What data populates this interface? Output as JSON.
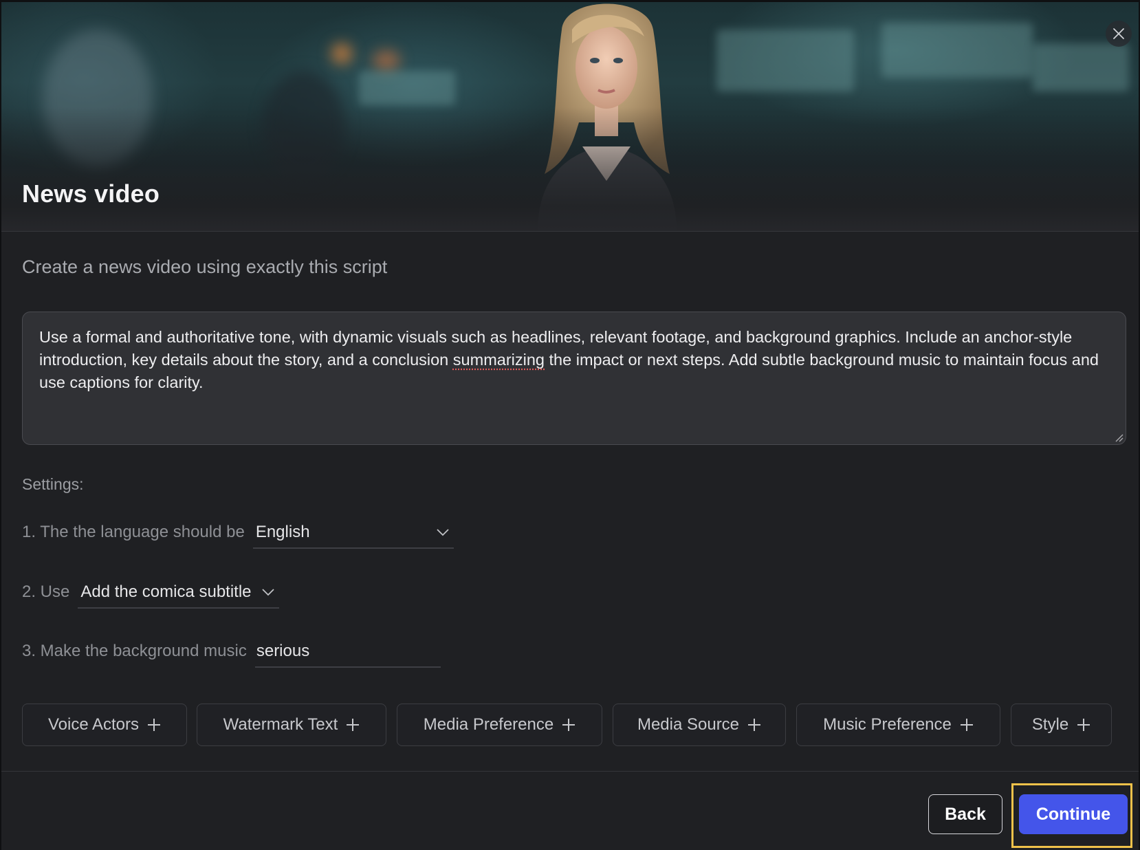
{
  "dialog": {
    "title": "News video",
    "subtitle": "Create a news video using exactly this script"
  },
  "script": {
    "part1": "Use a formal and authoritative tone, with dynamic visuals such as headlines, relevant footage, and background graphics. Include an anchor-style introduction, key details about the story, and a conclusion ",
    "misspelled_word": "summarizing",
    "part2": " the impact or next steps. Add subtle background music to maintain focus and use captions for clarity."
  },
  "settings": {
    "label": "Settings:",
    "language": {
      "prefix": "1. The the language should be",
      "value": "English"
    },
    "subtitle": {
      "prefix": "2. Use",
      "value": "Add the comica subtitle"
    },
    "music": {
      "prefix": "3. Make the background music",
      "value": "serious"
    }
  },
  "options": [
    {
      "label": "Voice Actors"
    },
    {
      "label": "Watermark Text"
    },
    {
      "label": "Media Preference"
    },
    {
      "label": "Media Source"
    },
    {
      "label": "Music Preference"
    },
    {
      "label": "Style"
    }
  ],
  "footer": {
    "back_label": "Back",
    "continue_label": "Continue"
  },
  "icons": {
    "close": "close-icon",
    "dropdown": "chevron-down-icon",
    "add": "plus-icon",
    "resize": "resize-grip-icon"
  },
  "colors": {
    "primary": "#4455ea",
    "focus_ring": "#f0c24a",
    "modal_bg": "#1f2023",
    "spellcheck": "#e05a5a"
  }
}
